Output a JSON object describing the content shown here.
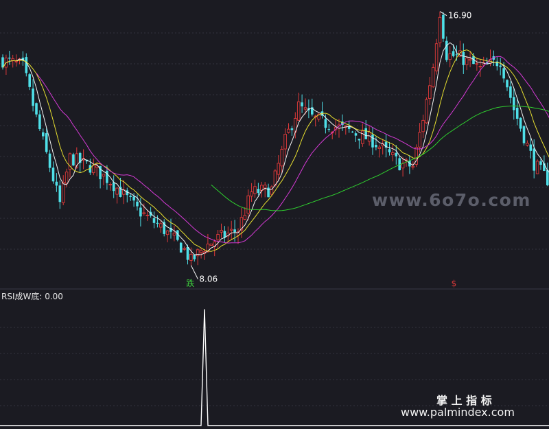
{
  "colors": {
    "background": "#1b1b22",
    "up": "#e03a3a",
    "down": "#4fe0e8",
    "ma5": "#f4f4f4",
    "ma10": "#e8e030",
    "ma20": "#d63ad6",
    "ma60": "#2fd02f",
    "signal_sell": "#3ecf3e",
    "signal_buy": "#e03a3a",
    "grid": "#33333d",
    "indicator_line": "#ffffff",
    "watermark_gray": "#5c5e6a"
  },
  "chart_data": [
    {
      "type": "candlestick",
      "panel": "main",
      "high_annotation": "16.90",
      "low_annotation": "8.06",
      "high_value": 16.9,
      "low_value": 8.06,
      "signals": [
        {
          "label": "跌",
          "bar": 56,
          "kind": "sell"
        },
        {
          "label": "$",
          "bar": 134,
          "kind": "buy"
        }
      ],
      "series": [
        {
          "name": "MA5",
          "color": "#f4f4f4"
        },
        {
          "name": "MA10",
          "color": "#e8e030"
        },
        {
          "name": "MA20",
          "color": "#d63ad6"
        },
        {
          "name": "MA60",
          "color": "#2fd02f"
        }
      ],
      "price_range": [
        7.5,
        17.3
      ]
    },
    {
      "type": "line",
      "panel": "indicator",
      "title": "RSI成W底: 0.00",
      "spike_bar": 60,
      "spike_value": 1,
      "baseline_value": 0,
      "ylim": [
        0,
        1.05
      ]
    }
  ],
  "watermarks": {
    "site_6070": "www.6o7o.com",
    "brand": "掌 上 指 标",
    "brand_url": "www.palmindex.com"
  }
}
